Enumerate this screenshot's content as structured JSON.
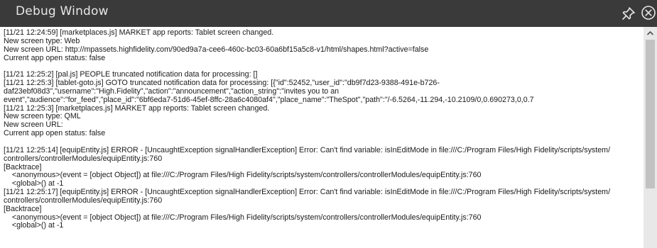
{
  "window": {
    "title": "Debug Window",
    "icons": [
      "pin-icon",
      "close-icon"
    ]
  },
  "log_lines": [
    "[11/21 12:24:59] [marketplaces.js] MARKET app reports: Tablet screen changed.",
    "New screen type: Web",
    "New screen URL: http://mpassets.highfidelity.com/90ed9a7a-cee6-460c-bc03-60a6bf15a5c8-v1/html/shapes.html?active=false",
    "Current app open status: false",
    "",
    "[11/21 12:25:2] [pal.js] PEOPLE truncated notification data for processing: []",
    "[11/21 12:25:3] [tablet-goto.js] GOTO truncated notification data for processing: [{\"id\":52452,\"user_id\":\"db9f7d23-9388-491e-b726-",
    "daf23ebf08d3\",\"username\":\"High.Fidelity\",\"action\":\"announcement\",\"action_string\":\"invites you to an",
    "event\",\"audience\":\"for_feed\",\"place_id\":\"6bf6eda7-51d6-45ef-8ffc-28a6c4080af4\",\"place_name\":\"TheSpot\",\"path\":\"/-6.5264,-11.294,-10.2109/0,0.690273,0,0.7",
    "[11/21 12:25:3] [marketplaces.js] MARKET app reports: Tablet screen changed.",
    "New screen type: QML",
    "New screen URL:",
    "Current app open status: false",
    "",
    "[11/21 12:25:14] [equipEntity.js] ERROR - [UncaughtException signalHandlerException] Error: Can't find variable: isInEditMode in file:///C:/Program Files/High Fidelity/scripts/system/",
    "controllers/controllerModules/equipEntity.js:760",
    "[Backtrace]",
    "    <anonymous>(event = [object Object]) at file:///C:/Program Files/High Fidelity/scripts/system/controllers/controllerModules/equipEntity.js:760",
    "    <global>() at -1",
    "[11/21 12:25:17] [equipEntity.js] ERROR - [UncaughtException signalHandlerException] Error: Can't find variable: isInEditMode in file:///C:/Program Files/High Fidelity/scripts/system/",
    "controllers/controllerModules/equipEntity.js:760",
    "[Backtrace]",
    "    <anonymous>(event = [object Object]) at file:///C:/Program Files/High Fidelity/scripts/system/controllers/controllerModules/equipEntity.js:760",
    "    <global>() at -1"
  ],
  "colors": {
    "titlebar": "#3a3a3a",
    "title_text": "#e6e6e6",
    "content_bg": "#ffffff",
    "log_text": "#1a1a1a",
    "scrollbar_track": "#e8e8e8",
    "scrollbar_thumb": "#c2c2c2"
  }
}
